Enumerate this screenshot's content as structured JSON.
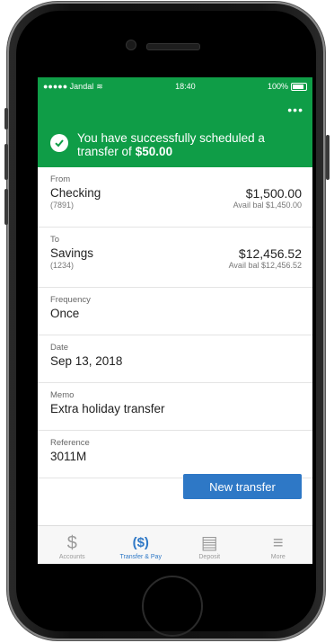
{
  "status_bar": {
    "carrier": "●●●●● Jandal",
    "wifi": "≋",
    "time": "18:40",
    "battery_pct": "100%"
  },
  "header": {
    "menu": "•••",
    "message": "You have successfully scheduled a transfer of",
    "amount": "$50.00"
  },
  "from": {
    "label": "From",
    "account": "Checking",
    "number": "(7891)",
    "balance": "$1,500.00",
    "avail": "Avail bal $1,450.00"
  },
  "to": {
    "label": "To",
    "account": "Savings",
    "number": "(1234)",
    "balance": "$12,456.52",
    "avail": "Avail bal $12,456.52"
  },
  "frequency": {
    "label": "Frequency",
    "value": "Once"
  },
  "date": {
    "label": "Date",
    "value": "Sep 13, 2018"
  },
  "memo": {
    "label": "Memo",
    "value": "Extra holiday transfer"
  },
  "reference": {
    "label": "Reference",
    "value": "3011M"
  },
  "button": {
    "new_transfer": "New transfer"
  },
  "tabs": [
    {
      "label": "Accounts",
      "icon": "dollar-icon",
      "glyph": "$"
    },
    {
      "label": "Transfer & Pay",
      "icon": "transfer-icon",
      "glyph": "($)"
    },
    {
      "label": "Deposit",
      "icon": "check-deposit-icon",
      "glyph": "▤"
    },
    {
      "label": "More",
      "icon": "menu-icon",
      "glyph": "≡"
    }
  ],
  "colors": {
    "brand_green": "#0f9d47",
    "button_blue": "#2e78c6"
  }
}
